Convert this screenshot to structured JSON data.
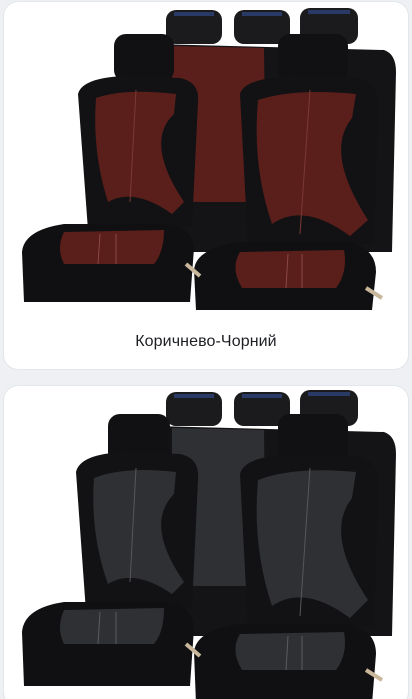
{
  "variants": [
    {
      "caption": "Коричнево-Чорний",
      "accent_color": "#5a1e1b",
      "trim_color": "#1a1a1a",
      "image_icon": "seat-cover-set-brown-black"
    },
    {
      "caption": "",
      "accent_color": "#2f3033",
      "trim_color": "#161616",
      "image_icon": "seat-cover-set-black"
    }
  ]
}
